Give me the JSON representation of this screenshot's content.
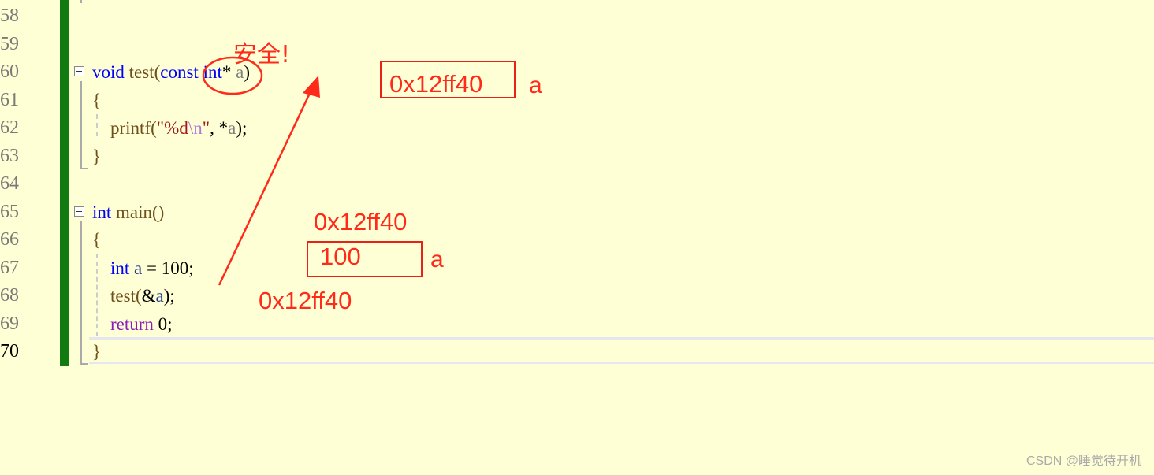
{
  "editor": {
    "line_numbers": [
      "58",
      "59",
      "60",
      "61",
      "62",
      "63",
      "64",
      "65",
      "66",
      "67",
      "68",
      "69",
      "70"
    ],
    "current_line": "70",
    "lines": {
      "l60": {
        "kw_void": "void",
        "fn_test": "test",
        "paren_open": "(",
        "kw_const": "const",
        "kw_int": "int",
        "star": "*",
        "var_a": "a",
        "paren_close": ")"
      },
      "l61": {
        "brace": "{"
      },
      "l62": {
        "fn_printf": "printf(",
        "str_fmt": "\"%d",
        "str_esc": "\\n",
        "str_end": "\"",
        "comma": ",",
        "deref": "*",
        "var_a": "a",
        "tail": ");"
      },
      "l63": {
        "brace": "}"
      },
      "l65": {
        "kw_int": "int",
        "fn_main": "main()"
      },
      "l66": {
        "brace": "{"
      },
      "l67": {
        "kw_int": "int",
        "var_a": "a",
        "assign": " = ",
        "num": "100",
        "semi": ";"
      },
      "l68": {
        "fn_test": "test(",
        "amp": "&",
        "var_a": "a",
        "tail": ");"
      },
      "l69": {
        "kw_return": "return",
        "num": "0",
        "semi": ";"
      },
      "l70": {
        "brace": "}"
      }
    }
  },
  "annotations": {
    "safe_label": "安全!",
    "param_box_value": "0x12ff40",
    "param_box_name": "a",
    "var_address": "0x12ff40",
    "var_box_value": "100",
    "var_box_name": "a",
    "arg_address": "0x12ff40",
    "color": "#ff2a1a"
  },
  "watermark": "CSDN @睡觉待开机"
}
